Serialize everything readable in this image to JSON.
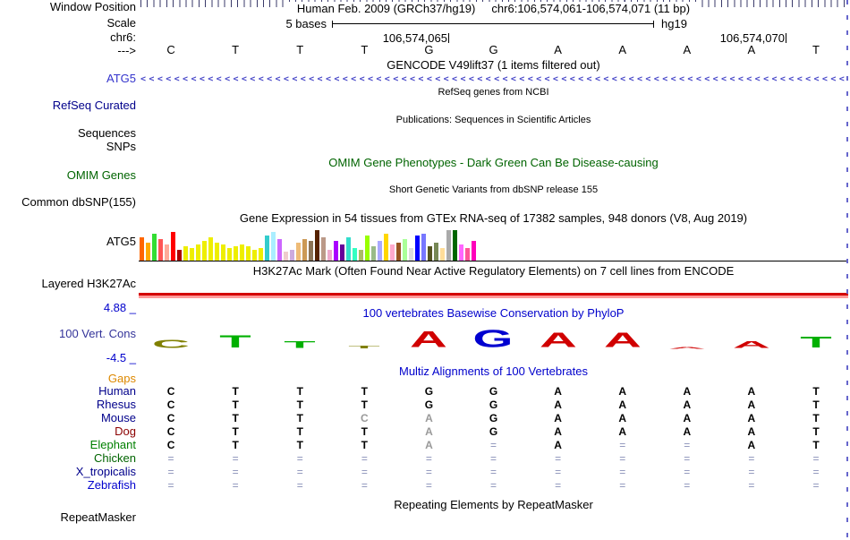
{
  "colors": {
    "title_blue": "#0000CC",
    "omim_green": "#006400",
    "navy": "#00008B",
    "gencode_blue": "#3333CC",
    "cons_label_blue": "#333399",
    "gaps_orange": "#DD8800"
  },
  "ruler": {
    "window_position_label": "Window Position",
    "title": "Human Feb. 2009 (GRCh37/hg19)     chr6:106,574,061-106,574,071 (11 bp)"
  },
  "scale": {
    "label": "Scale",
    "value": "5 bases",
    "assembly": "hg19"
  },
  "position": {
    "chrom_label": "chr6:",
    "coord_left": "106,574,065",
    "coord_right": "106,574,070",
    "strand_label": "--->"
  },
  "bases": [
    "C",
    "T",
    "T",
    "T",
    "G",
    "G",
    "A",
    "A",
    "A",
    "A",
    "T"
  ],
  "gencode": {
    "title": "GENCODE V49lift37 (1 items filtered out)",
    "gene_label": "ATG5",
    "arrow": "<",
    "color": "#4848C8"
  },
  "refseq": {
    "title": "RefSeq genes from NCBI",
    "label": "RefSeq Curated"
  },
  "publications": {
    "title": "Publications: Sequences in Scientific Articles",
    "label_sequences": "Sequences",
    "label_snps": "SNPs"
  },
  "omim": {
    "title": "OMIM Gene Phenotypes - Dark Green Can Be Disease-causing",
    "label": "OMIM Genes"
  },
  "dbsnp": {
    "title": "Short Genetic Variants from dbSNP release 155",
    "label": "Common dbSNP(155)"
  },
  "gtex": {
    "title": "Gene Expression in 54 tissues from GTEx RNA-seq of 17382 samples, 948 donors (V8, Aug 2019)",
    "label": "ATG5",
    "bars": [
      {
        "c": "#FF6600",
        "h": 26
      },
      {
        "c": "#FFAA00",
        "h": 20
      },
      {
        "c": "#33DD33",
        "h": 30
      },
      {
        "c": "#FF5555",
        "h": 24
      },
      {
        "c": "#FFAA99",
        "h": 18
      },
      {
        "c": "#FF0000",
        "h": 32
      },
      {
        "c": "#AA0000",
        "h": 12
      },
      {
        "c": "#EEEE00",
        "h": 16
      },
      {
        "c": "#EEEE00",
        "h": 14
      },
      {
        "c": "#EEEE00",
        "h": 18
      },
      {
        "c": "#EEEE00",
        "h": 22
      },
      {
        "c": "#EEEE00",
        "h": 26
      },
      {
        "c": "#EEEE00",
        "h": 20
      },
      {
        "c": "#EEEE00",
        "h": 18
      },
      {
        "c": "#EEEE00",
        "h": 14
      },
      {
        "c": "#EEEE00",
        "h": 16
      },
      {
        "c": "#EEEE00",
        "h": 18
      },
      {
        "c": "#EEEE00",
        "h": 16
      },
      {
        "c": "#EEEE00",
        "h": 12
      },
      {
        "c": "#EEEE00",
        "h": 14
      },
      {
        "c": "#33CCCC",
        "h": 28
      },
      {
        "c": "#AAEEFF",
        "h": 32
      },
      {
        "c": "#CC66FF",
        "h": 24
      },
      {
        "c": "#EECCCC",
        "h": 10
      },
      {
        "c": "#CCAADD",
        "h": 12
      },
      {
        "c": "#EEBB77",
        "h": 20
      },
      {
        "c": "#CC9955",
        "h": 24
      },
      {
        "c": "#8B7355",
        "h": 22
      },
      {
        "c": "#552200",
        "h": 34
      },
      {
        "c": "#BB9988",
        "h": 26
      },
      {
        "c": "#EEAACC",
        "h": 12
      },
      {
        "c": "#AA00FF",
        "h": 22
      },
      {
        "c": "#660099",
        "h": 18
      },
      {
        "c": "#33DDCC",
        "h": 26
      },
      {
        "c": "#33FFC2",
        "h": 14
      },
      {
        "c": "#AABB66",
        "h": 12
      },
      {
        "c": "#99FF00",
        "h": 28
      },
      {
        "c": "#99BB88",
        "h": 16
      },
      {
        "c": "#AAAAFF",
        "h": 22
      },
      {
        "c": "#FFD700",
        "h": 30
      },
      {
        "c": "#FFAACC",
        "h": 18
      },
      {
        "c": "#995522",
        "h": 20
      },
      {
        "c": "#AAFF99",
        "h": 24
      },
      {
        "c": "#DDDDDD",
        "h": 14
      },
      {
        "c": "#0000FF",
        "h": 28
      },
      {
        "c": "#7777FF",
        "h": 30
      },
      {
        "c": "#555522",
        "h": 16
      },
      {
        "c": "#778855",
        "h": 20
      },
      {
        "c": "#FFDD99",
        "h": 14
      },
      {
        "c": "#AAAAAA",
        "h": 34
      },
      {
        "c": "#006600",
        "h": 34
      },
      {
        "c": "#FF66FF",
        "h": 18
      },
      {
        "c": "#FF5599",
        "h": 14
      },
      {
        "c": "#FF00BB",
        "h": 22
      }
    ]
  },
  "h3k27ac": {
    "title": "H3K27Ac Mark (Often Found Near Active Regulatory Elements) on 7 cell lines from ENCODE",
    "label": "Layered H3K27Ac",
    "band_colors": [
      "#D40000",
      "#FF9999"
    ]
  },
  "phylop": {
    "title": "100 vertebrates Basewise Conservation by PhyloP",
    "label": "100 Vert. Cons",
    "max": "4.88 _",
    "min": "-4.5 _",
    "logo": [
      {
        "letter": "C",
        "color": "#808000",
        "h": 9
      },
      {
        "letter": "T",
        "color": "#00B000",
        "h": 14
      },
      {
        "letter": "T",
        "color": "#00B000",
        "h": 8
      },
      {
        "letter": "T",
        "color": "#808000",
        "h": 3
      },
      {
        "letter": "A",
        "color": "#D00000",
        "h": 18
      },
      {
        "letter": "G",
        "color": "#0000D0",
        "h": 20
      },
      {
        "letter": "A",
        "color": "#D00000",
        "h": 17
      },
      {
        "letter": "A",
        "color": "#D00000",
        "h": 17
      },
      {
        "letter": "A",
        "color": "#D00000",
        "h": 2
      },
      {
        "letter": "A",
        "color": "#D00000",
        "h": 8
      },
      {
        "letter": "T",
        "color": "#00B000",
        "h": 13
      }
    ]
  },
  "multiz": {
    "title": "Multiz Alignments of 100 Vertebrates",
    "gaps_label": "Gaps",
    "rows": [
      {
        "name": "Human",
        "color": "#00008B",
        "cells": [
          "C",
          "T",
          "T",
          "T",
          "G",
          "G",
          "A",
          "A",
          "A",
          "A",
          "T"
        ],
        "dim": []
      },
      {
        "name": "Rhesus",
        "color": "#00008B",
        "cells": [
          "C",
          "T",
          "T",
          "T",
          "G",
          "G",
          "A",
          "A",
          "A",
          "A",
          "T"
        ],
        "dim": []
      },
      {
        "name": "Mouse",
        "color": "#00008B",
        "cells": [
          "C",
          "T",
          "T",
          "C",
          "A",
          "G",
          "A",
          "A",
          "A",
          "A",
          "T"
        ],
        "dim": [
          3,
          4
        ]
      },
      {
        "name": "Dog",
        "color": "#8B0000",
        "cells": [
          "C",
          "T",
          "T",
          "T",
          "A",
          "G",
          "A",
          "A",
          "A",
          "A",
          "T"
        ],
        "dim": [
          4
        ]
      },
      {
        "name": "Elephant",
        "color": "#008000",
        "cells": [
          "C",
          "T",
          "T",
          "T",
          "A",
          "=",
          "A",
          "=",
          "=",
          "A",
          "T"
        ],
        "dim": [
          4
        ]
      },
      {
        "name": "Chicken",
        "color": "#006400",
        "cells": [
          "=",
          "=",
          "=",
          "=",
          "=",
          "=",
          "=",
          "=",
          "=",
          "=",
          "="
        ],
        "dim": []
      },
      {
        "name": "X_tropicalis",
        "color": "#00008B",
        "cells": [
          "=",
          "=",
          "=",
          "=",
          "=",
          "=",
          "=",
          "=",
          "=",
          "=",
          "="
        ],
        "dim": []
      },
      {
        "name": "Zebrafish",
        "color": "#0000CD",
        "cells": [
          "=",
          "=",
          "=",
          "=",
          "=",
          "=",
          "=",
          "=",
          "=",
          "=",
          "="
        ],
        "dim": []
      }
    ]
  },
  "repeatmasker": {
    "title": "Repeating Elements by RepeatMasker",
    "label": "RepeatMasker"
  }
}
